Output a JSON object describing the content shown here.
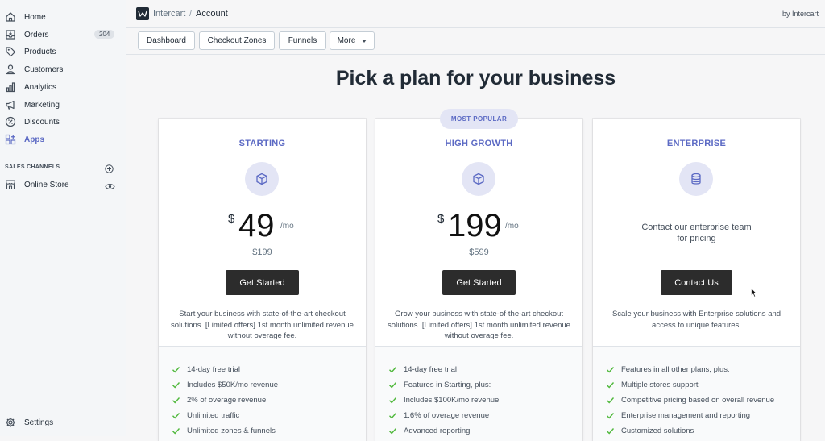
{
  "sidebar": {
    "items": [
      {
        "label": "Home",
        "icon": "home-icon"
      },
      {
        "label": "Orders",
        "icon": "orders-icon",
        "badge": "204"
      },
      {
        "label": "Products",
        "icon": "tag-icon"
      },
      {
        "label": "Customers",
        "icon": "person-icon"
      },
      {
        "label": "Analytics",
        "icon": "bar-chart-icon"
      },
      {
        "label": "Marketing",
        "icon": "megaphone-icon"
      },
      {
        "label": "Discounts",
        "icon": "discount-icon"
      },
      {
        "label": "Apps",
        "icon": "apps-icon",
        "active": true
      }
    ],
    "channels_title": "SALES CHANNELS",
    "online_store": "Online Store",
    "settings": "Settings"
  },
  "topbar": {
    "app": "Intercart",
    "separator": "/",
    "page": "Account",
    "byline": "by Intercart"
  },
  "tabs": {
    "dashboard": "Dashboard",
    "checkout_zones": "Checkout Zones",
    "funnels": "Funnels",
    "more": "More"
  },
  "heading": "Pick a plan for your business",
  "popular_badge": "MOST POPULAR",
  "accent_color": "#5c6ac4",
  "plans": [
    {
      "name": "STARTING",
      "icon": "cube-icon",
      "currency": "$",
      "price": "49",
      "per": "/mo",
      "old_price": "$199",
      "cta": "Get Started",
      "description": "Start your business with state-of-the-art checkout solutions. [Limited offers] 1st month unlimited revenue without overage fee.",
      "features": [
        "14-day free trial",
        "Includes $50K/mo revenue",
        "2% of overage revenue",
        "Unlimited traffic",
        "Unlimited zones & funnels"
      ]
    },
    {
      "name": "HIGH GROWTH",
      "icon": "cube-icon",
      "currency": "$",
      "price": "199",
      "per": "/mo",
      "old_price": "$599",
      "cta": "Get Started",
      "description": "Grow your business with state-of-the-art checkout solutions. [Limited offers] 1st month unlimited revenue without overage fee.",
      "features": [
        "14-day free trial",
        "Features in Starting, plus:",
        "Includes $100K/mo revenue",
        "1.6% of overage revenue",
        "Advanced reporting"
      ]
    },
    {
      "name": "ENTERPRISE",
      "icon": "database-icon",
      "contact_text": "Contact our enterprise team for pricing",
      "cta": "Contact Us",
      "description": "Scale your business with Enterprise solutions and access to unique features.",
      "features": [
        "Features in all other plans, plus:",
        "Multiple stores support",
        "Competitive pricing based on overall revenue",
        "Enterprise management and reporting",
        "Customized solutions"
      ]
    }
  ]
}
